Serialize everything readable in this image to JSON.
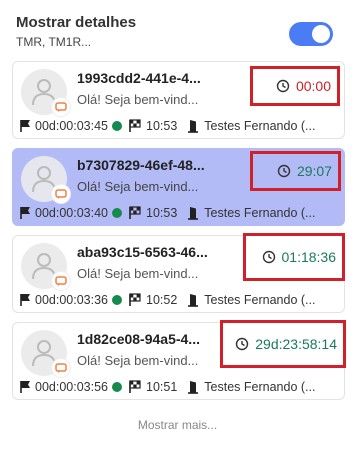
{
  "header": {
    "title": "Mostrar detalhes",
    "subtitle": "TMR, TM1R...",
    "toggle_on": true
  },
  "colors": {
    "accent": "#4a7cf5",
    "selected_bg": "#b3bbf7",
    "status_online": "#168a4e",
    "timer_red": "#d0202a",
    "timer_green": "#1a7a5c",
    "highlight_box": "#d0202a"
  },
  "cards": [
    {
      "id": "1993cdd2-441e-4...",
      "message": "Olá! Seja bem-vind...",
      "timer": "00:00",
      "timer_color": "#d0202a",
      "duration": "00d:00:03:45",
      "time": "10:53",
      "agent": "Testes Fernando (...",
      "selected": false
    },
    {
      "id": "b7307829-46ef-48...",
      "message": "Olá! Seja bem-vind...",
      "timer": "29:07",
      "timer_color": "#1a7a5c",
      "duration": "00d:00:03:40",
      "time": "10:53",
      "agent": "Testes Fernando (...",
      "selected": true
    },
    {
      "id": "aba93c15-6563-46...",
      "message": "Olá! Seja bem-vind...",
      "timer": "01:18:36",
      "timer_color": "#1a7a5c",
      "duration": "00d:00:03:36",
      "time": "10:52",
      "agent": "Testes Fernando (...",
      "selected": false
    },
    {
      "id": "1d82ce08-94a5-4...",
      "message": "Olá! Seja bem-vind...",
      "timer": "29d:23:58:14",
      "timer_color": "#1a7a5c",
      "duration": "00d:00:03:56",
      "time": "10:51",
      "agent": "Testes Fernando (...",
      "selected": false
    }
  ],
  "footer": {
    "more_label": "Mostrar mais..."
  }
}
